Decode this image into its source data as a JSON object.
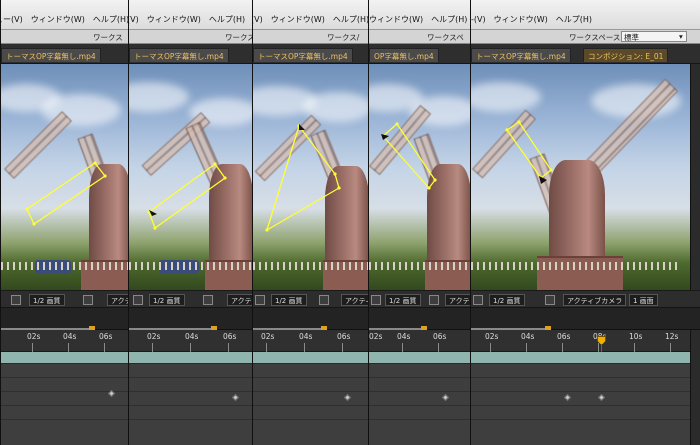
{
  "panels": [
    {
      "id": "s1",
      "menu": "ュー(V)　ウィンドウ(W)　ヘルプ(H)",
      "workspace": "ワークス",
      "tab": "トーマスOP字幕無し.mp4",
      "zoom": "1/2 画質",
      "active": "アクティ",
      "timecodes": [
        "02s",
        "04s",
        "06s"
      ]
    },
    {
      "id": "s2",
      "menu": "(V)　ウィンドウ(W)　ヘルプ(H)",
      "workspace": "ワークス",
      "tab": "トーマスOP字幕無し.mp4",
      "zoom": "1/2 画質",
      "active": "アクティ",
      "timecodes": [
        "02s",
        "04s",
        "06s"
      ]
    },
    {
      "id": "s3",
      "menu": "(V)　ウィンドウ(W)　ヘルプ(H)",
      "workspace": "ワークス/",
      "tab": "トーマスOP字幕無し.mp4",
      "zoom": "1/2 画質",
      "active": "アクティ",
      "timecodes": [
        "02s",
        "04s",
        "06s"
      ]
    },
    {
      "id": "s4",
      "menu": "ウィンドウ(W)　ヘルプ(H)",
      "workspace": "ワークスペ",
      "tab": "OP字幕無し.mp4",
      "zoom": "1/2 画質",
      "active": "アクティ",
      "timecodes": [
        "02s",
        "04s",
        "06s"
      ]
    },
    {
      "id": "s5",
      "menu": "-(V)　ウィンドウ(W)　ヘルプ(H)",
      "workspace": "ワークスペース：",
      "workspace_value": "標準",
      "tab": "トーマスOP字幕無し.mp4",
      "tab2": "コンポジション: E_01",
      "zoom": "1/2 画質",
      "active": "アクティブカメラ",
      "view": "1 画面",
      "timecodes": [
        "02s",
        "04s",
        "06s",
        "08s",
        "10s",
        "12s"
      ]
    }
  ],
  "icons": {
    "search": "search-icon",
    "camera": "camera-icon",
    "grid": "grid-icon",
    "mask": "mask-icon",
    "chevron": "chevron-down-icon",
    "keyframe": "keyframe-icon",
    "playhead": "playhead-icon"
  },
  "colors": {
    "accent": "#f0b000",
    "mask": "#ffff33",
    "playhead": "#e03030"
  }
}
